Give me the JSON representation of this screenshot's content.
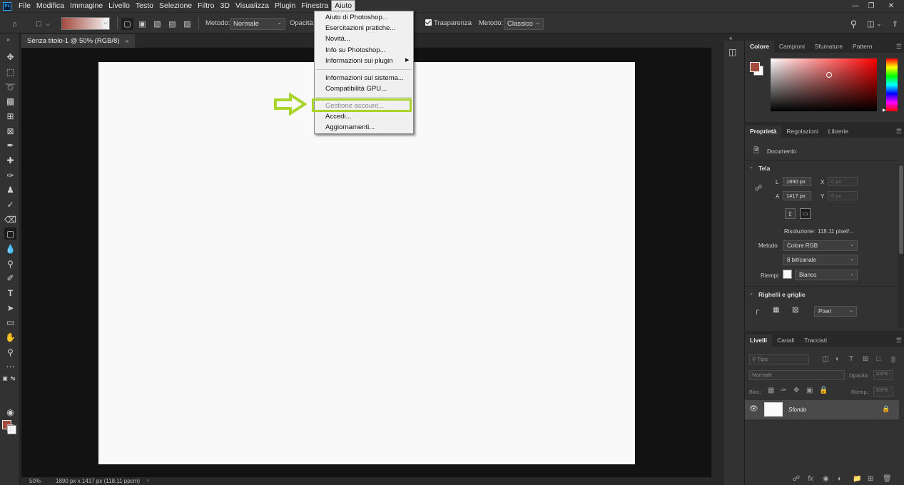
{
  "menubar": {
    "app_icon": "Ps",
    "items": [
      "File",
      "Modifica",
      "Immagine",
      "Livello",
      "Testo",
      "Selezione",
      "Filtro",
      "3D",
      "Visualizza",
      "Plugin",
      "Finestra",
      "Aiuto"
    ],
    "active_item": "Aiuto",
    "window_controls": [
      "minimize-icon",
      "restore-icon",
      "close-icon"
    ]
  },
  "options_bar": {
    "metodo_label": "Metodo:",
    "metodo_value": "Normale",
    "opacita_label": "Opacità:",
    "trasparenza_label": "Trasparenza",
    "trasparenza_checked": true,
    "metodo2_label": "Metodo:",
    "metodo2_value": "Classico",
    "gradient_colors": [
      "#a44a3f",
      "#f5f5f5"
    ]
  },
  "document_tab": {
    "title": "Senza titolo-1 @ 50% (RGB/8)",
    "close": "×"
  },
  "help_menu": {
    "items": [
      {
        "label": "Aiuto di Photoshop...",
        "enabled": true
      },
      {
        "label": "Esercitazioni pratiche...",
        "enabled": true
      },
      {
        "label": "Novità...",
        "enabled": true
      },
      {
        "label": "Info su Photoshop...",
        "enabled": true
      },
      {
        "label": "Informazioni sui plugin",
        "enabled": true,
        "submenu": true
      },
      {
        "label": "Informazioni sul sistema...",
        "enabled": true
      },
      {
        "label": "Compatibilità GPU...",
        "enabled": true
      },
      {
        "label": "Gestione account...",
        "enabled": false
      },
      {
        "label": "Accedi...",
        "enabled": true
      },
      {
        "label": "Aggiornamenti...",
        "enabled": true
      }
    ],
    "highlight_color": "#a9d42c"
  },
  "status_bar": {
    "zoom": "50%",
    "doc_info": "1890 px x 1417 px (118,11 ppcm)",
    "arrow": "›"
  },
  "color_panel": {
    "tabs": [
      "Colore",
      "Campioni",
      "Sfumature",
      "Pattern"
    ],
    "active_tab": "Colore",
    "foreground": "#a5493d",
    "background": "#fafafa"
  },
  "properties_panel": {
    "tabs": [
      "Proprietà",
      "Regolazioni",
      "Librerie"
    ],
    "active_tab": "Proprietà",
    "doc_label": "Documento",
    "tela_title": "Tela",
    "l_label": "L",
    "l_value": "1890 px",
    "a_label": "A",
    "a_value": "1417 px",
    "x_label": "X",
    "x_value": "0 px",
    "y_label": "Y",
    "y_value": "0 px",
    "risoluzione_label": "Risoluzione:",
    "risoluzione_value": "118.11  pixel/...",
    "metodo_label": "Metodo",
    "metodo_value": "Colore RGB",
    "bit_value": "8 bit/canale",
    "riempi_label": "Riempi",
    "riempi_value": "Bianco",
    "righelli_title": "Righelli e griglie",
    "unit_value": "Pixel"
  },
  "layers_panel": {
    "tabs": [
      "Livelli",
      "Canali",
      "Tracciati"
    ],
    "active_tab": "Livelli",
    "search_placeholder": "Tipo",
    "blend_mode": "Normale",
    "opacity_label": "Opacità:",
    "opacity_value": "100%",
    "lock_label": "Bloc.:",
    "fill_label": "Riemp.:",
    "fill_value": "100%",
    "layers": [
      {
        "name": "Sfondo",
        "visible": true,
        "locked": true
      }
    ]
  }
}
